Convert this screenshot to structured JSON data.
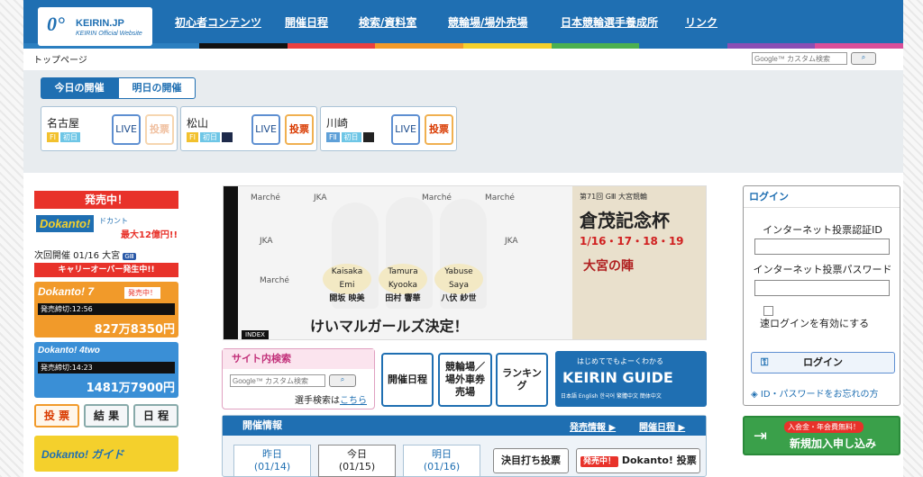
{
  "site": {
    "logo_text": "KEIRIN.JP",
    "logo_sub": "KEIRIN Official Website",
    "logo_mark": "0°"
  },
  "nav": [
    "初心者コンテンツ",
    "開催日程",
    "検索/資料室",
    "競輪場/場外売場",
    "日本競輪選手養成所",
    "リンク"
  ],
  "stripes": [
    "#2b7fc0",
    "#2b7fc0",
    "#111111",
    "#e94040",
    "#f19a2a",
    "#f4d02c",
    "#4cb050",
    "#1f6fb2",
    "#8a4fb5",
    "#d94f9a"
  ],
  "breadcrumb": "トップページ",
  "search": {
    "placeholder": "Google™ カスタム検索",
    "button": "検索"
  },
  "day_tabs": {
    "today": "今日の開催",
    "tomorrow": "明日の開催"
  },
  "venues": [
    {
      "name": "名古屋",
      "grade": "FⅠ",
      "day": "初日",
      "live": "LIVE",
      "bet": "投票",
      "bet_active": false
    },
    {
      "name": "松山",
      "grade": "FⅠ",
      "day": "初日",
      "live": "LIVE",
      "bet": "投票",
      "bet_active": true
    },
    {
      "name": "川崎",
      "grade": "FⅡ",
      "day": "初日",
      "live": "LIVE",
      "bet": "投票",
      "bet_active": true
    }
  ],
  "left": {
    "on_sale": "発売中！",
    "dokanto": "Dokanto!",
    "dokanto_kana": "ドカント",
    "dokanto_max": "最大12億円!!",
    "next_event": "次回開催 01/16 大宮",
    "next_grade": "GⅢ",
    "carryover": "キャリーオーバー発生中!!",
    "d7_title": "Dokanto! 7",
    "d7_status": "発売中！",
    "d7_deadline": "発売締切:12:56",
    "d7_amount": "827万8350円",
    "d4_title": "Dokanto! 4two",
    "d4_deadline": "発売締切:14:23",
    "d4_amount": "1481万7900円",
    "btn_vote": "投 票",
    "btn_result": "結 果",
    "btn_schedule": "日 程",
    "guide": "Dokanto! ガイド"
  },
  "slider": {
    "caption": "けいマルガールズ決定！",
    "index": "INDEX",
    "brand": "Marché",
    "org": "JKA",
    "members": [
      {
        "roman": "Kaisaka Emi",
        "name": "開坂 映美"
      },
      {
        "roman": "Tamura Kyooka",
        "name": "田村 響華"
      },
      {
        "roman": "Yabuse Saya",
        "name": "八伏 紗世"
      }
    ],
    "side_sub": "第71回 GⅢ 大宮競輪",
    "side_title": "倉茂記念杯",
    "side_dates": "1/16・17・18・19",
    "side_tag": "大宮の陣"
  },
  "site_search": {
    "title": "サイト内検索",
    "placeholder": "Google™ カスタム検索",
    "button": "検索",
    "player_label": "選手検索は",
    "player_link": "こちら"
  },
  "quick": {
    "schedule": "開催日程",
    "venue_line1": "競輪場／",
    "venue_line2": "場外車券",
    "venue_line3": "売場",
    "ranking": "ランキング"
  },
  "guide": {
    "top": "はじめてでもよーくわかる",
    "title": "KEIRIN GUIDE",
    "langs": "日本語 English 한국어 繁體中文 簡体中文"
  },
  "info": {
    "title": "開催情報",
    "link1": "発売情報 ▶",
    "link2": "開催日程 ▶"
  },
  "info_tabs": {
    "yesterday": "昨日",
    "yesterday_date": "(01/14)",
    "today": "今日",
    "today_date": "(01/15)",
    "tomorrow": "明日",
    "tomorrow_date": "(01/16)"
  },
  "info_buttons": {
    "kessho": "決目打ち投票",
    "badge": "発売中！",
    "dokanto": "Dokanto! 投票"
  },
  "login": {
    "title": "ログイン",
    "id_label": "インターネット投票認証ID",
    "pw_label": "インターネット投票パスワード",
    "fast": "速ログインを有効にする",
    "button": "ログイン",
    "forgot": "ID・パスワードをお忘れの方"
  },
  "register": {
    "badge": "入会金・年会費無料！",
    "label": "新規加入申し込み"
  }
}
